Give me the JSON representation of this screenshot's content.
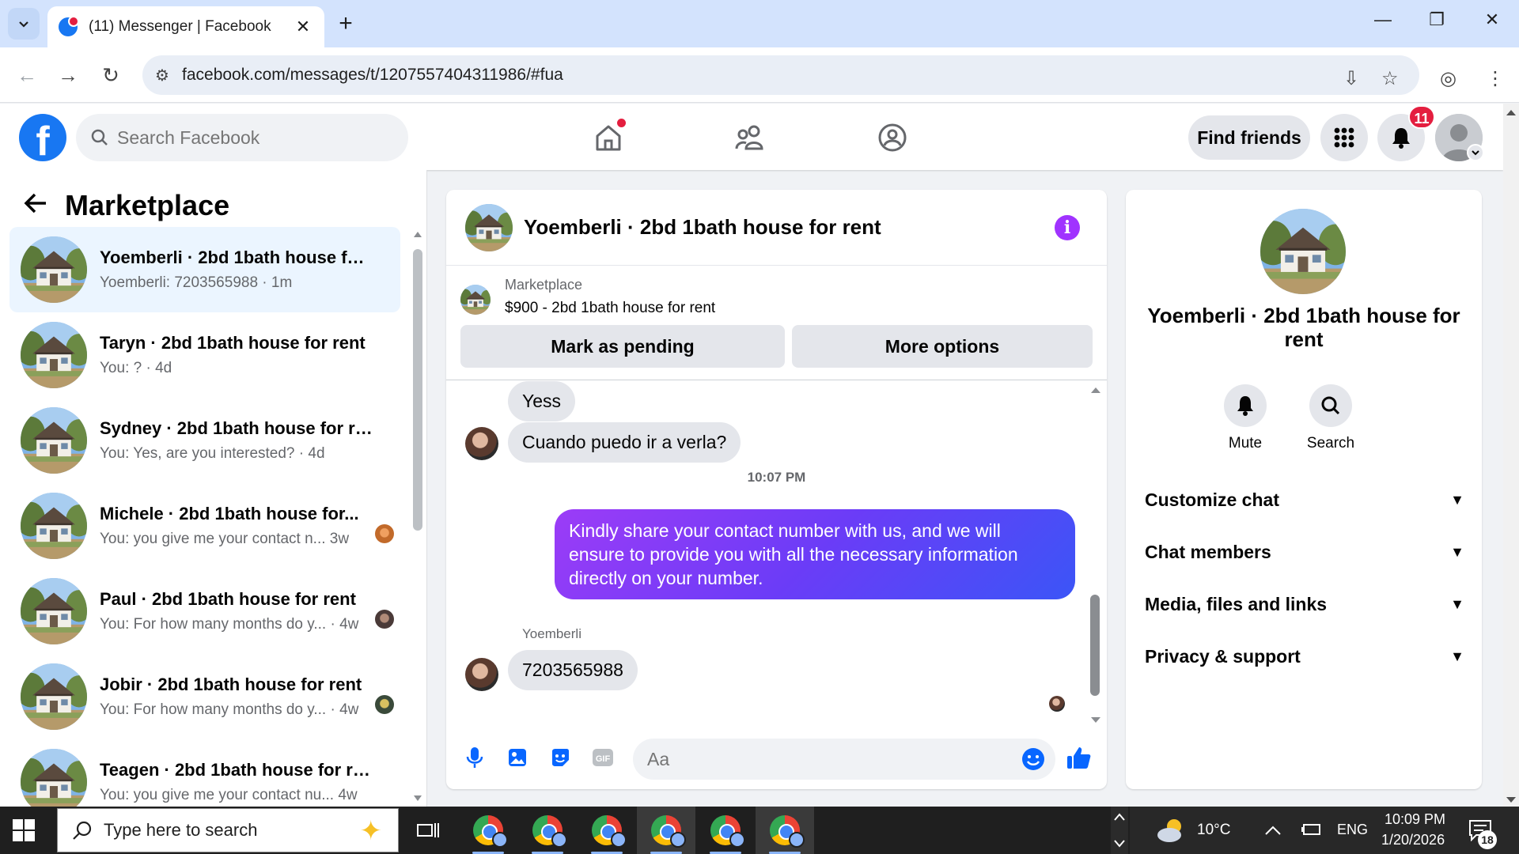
{
  "browser": {
    "tab_title": "(11) Messenger | Facebook",
    "url": "facebook.com/messages/t/1207557404311986/#fua"
  },
  "fb": {
    "search_placeholder": "Search Facebook",
    "find_friends": "Find friends",
    "notification_count": "11"
  },
  "left": {
    "title": "Marketplace",
    "conversations": [
      {
        "name": "Yoemberli · 2bd 1bath house for ...",
        "preview": "Yoemberli: 7203565988 · 1m"
      },
      {
        "name": "Taryn · 2bd 1bath house for rent",
        "preview": "You: ? · 4d"
      },
      {
        "name": "Sydney · 2bd 1bath house for rent",
        "preview": "You: Yes, are you interested? · 4d"
      },
      {
        "name": "Michele · 2bd 1bath house for...",
        "preview": "You: you give me your contact n...  3w"
      },
      {
        "name": "Paul · 2bd 1bath house for rent",
        "preview": "You: For how many months do y... · 4w"
      },
      {
        "name": "Jobir · 2bd 1bath house for rent",
        "preview": "You: For how many months do y... · 4w"
      },
      {
        "name": "Teagen · 2bd 1bath house for rent",
        "preview": "You: you give me your contact nu...     4w"
      }
    ]
  },
  "chat": {
    "title": "Yoemberli · 2bd 1bath house for rent",
    "marketplace_label": "Marketplace",
    "listing": "$900 - 2bd 1bath house for rent",
    "mark_pending": "Mark as pending",
    "more_options": "More options",
    "messages": {
      "in1": "Yess",
      "in2": "Cuando puedo ir a verla?",
      "timestamp": "10:07 PM",
      "out1": "Kindly share your contact number with us, and we will ensure to provide you with all the necessary information directly on your number.",
      "sender": "Yoemberli",
      "in3": "7203565988"
    },
    "composer_placeholder": "Aa"
  },
  "right": {
    "name": "Yoemberli · 2bd 1bath house for rent",
    "mute": "Mute",
    "search": "Search",
    "rows": [
      "Customize chat",
      "Chat members",
      "Media, files and links",
      "Privacy & support"
    ]
  },
  "taskbar": {
    "search_text": "Type here to search",
    "weather": "10°C",
    "lang": "ENG",
    "time": "10:09 PM",
    "date": "1/20/2026",
    "notif_count": "18"
  },
  "colors": {
    "fb_blue": "#1877f2",
    "bubble_gradient": [
      "#9c3cf7",
      "#3b55f7"
    ],
    "notification_red": "#e41e3f",
    "active_conv_bg": "#ebf5ff"
  }
}
